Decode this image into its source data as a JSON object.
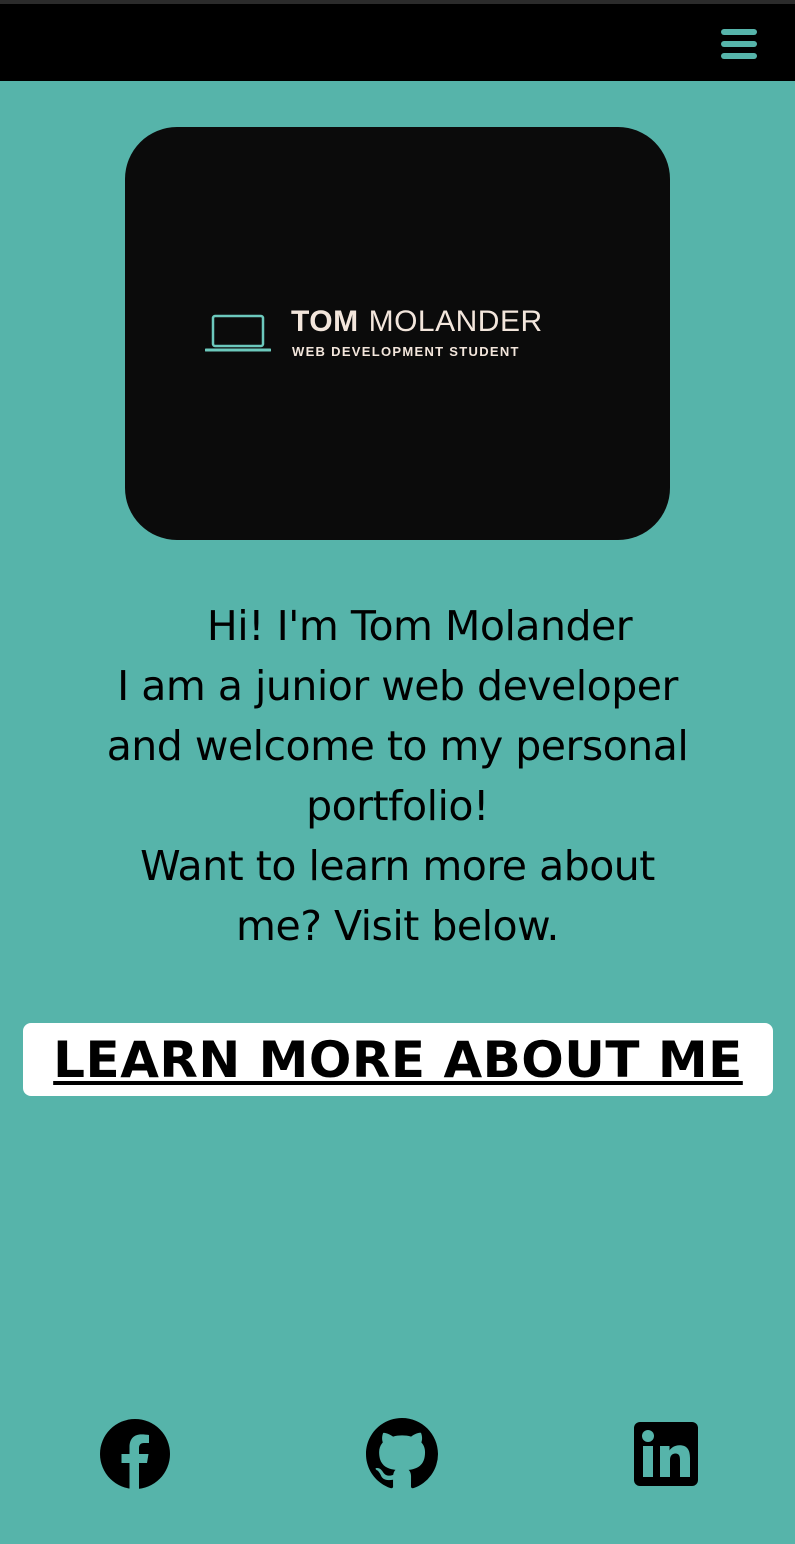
{
  "nav": {
    "menu_icon": "hamburger-menu-icon"
  },
  "logo": {
    "icon": "laptop-icon",
    "first_name": "TOM",
    "last_name": "MOLANDER",
    "subtitle": "WEB DEVELOPMENT STUDENT"
  },
  "intro": {
    "line1": "Hi! I'm Tom Molander",
    "line2": "I am a junior web developer",
    "line3": "and welcome to my personal",
    "line4": "portfolio!",
    "line5": "Want to learn more about",
    "line6": "me? Visit below."
  },
  "cta": {
    "label": "LEARN MORE ABOUT ME"
  },
  "social": [
    {
      "icon": "facebook-icon"
    },
    {
      "icon": "github-icon"
    },
    {
      "icon": "linkedin-icon"
    }
  ],
  "colors": {
    "background": "#56b4aa",
    "navbar": "#000000",
    "accent": "#56b4aa",
    "logo_text": "#f3e6dc"
  }
}
